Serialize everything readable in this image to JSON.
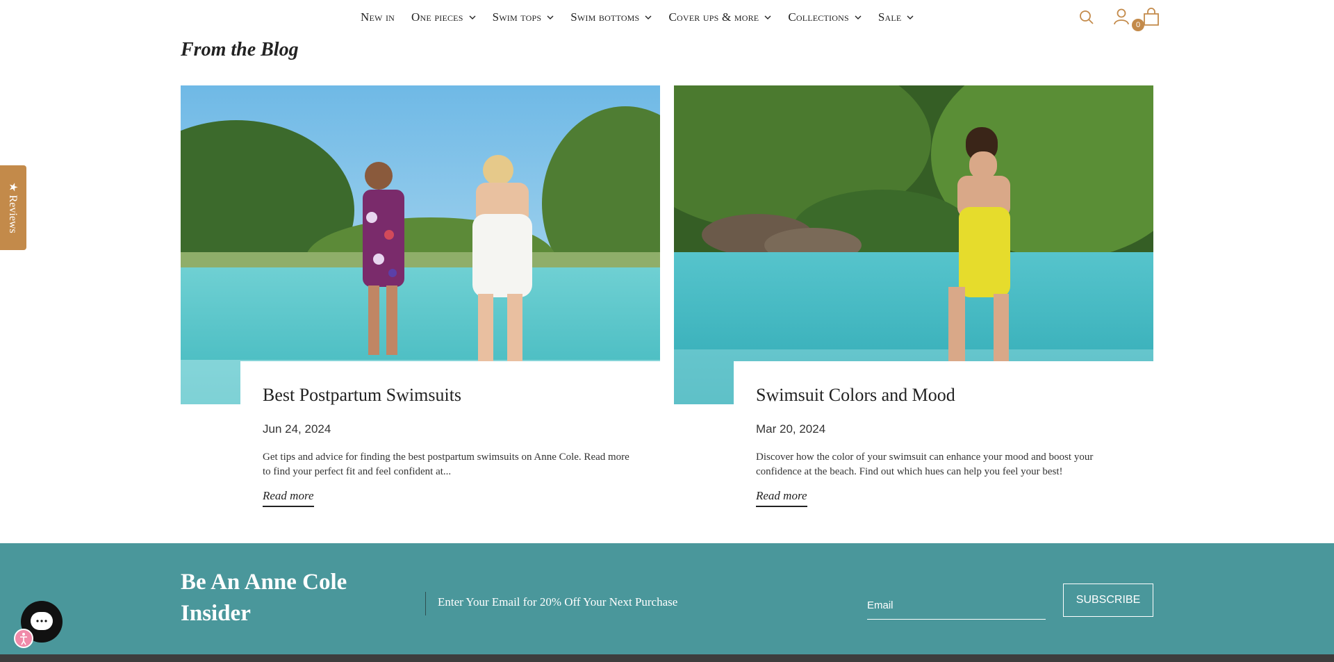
{
  "nav": {
    "items": [
      {
        "label": "New in",
        "has_dropdown": false
      },
      {
        "label": "One pieces",
        "has_dropdown": true
      },
      {
        "label": "Swim tops",
        "has_dropdown": true
      },
      {
        "label": "Swim bottoms",
        "has_dropdown": true
      },
      {
        "label": "Cover ups & more",
        "has_dropdown": true
      },
      {
        "label": "Collections",
        "has_dropdown": true
      },
      {
        "label": "Sale",
        "has_dropdown": true
      }
    ],
    "icons": [
      "search-icon",
      "account-icon",
      "cart-icon"
    ],
    "cart_count": "0",
    "accent_color": "#c38a4a"
  },
  "blog": {
    "heading": "From the Blog",
    "posts": [
      {
        "title": "Best Postpartum Swimsuits",
        "date": "Jun 24, 2024",
        "excerpt": "Get tips and advice for finding the best postpartum swimsuits on Anne Cole. Read more to find your perfect fit and feel confident at...",
        "read_more": "Read more"
      },
      {
        "title": "Swimsuit Colors and Mood",
        "date": "Mar 20, 2024",
        "excerpt": "Discover how the color of your swimsuit can enhance your mood and boost your confidence at the beach. Find out which hues can help you feel your best!",
        "read_more": "Read more"
      }
    ]
  },
  "reviews_tab": {
    "label": "★ Reviews"
  },
  "newsletter": {
    "title": "Be An Anne Cole Insider",
    "text": "Enter Your Email for 20% Off Your Next Purchase",
    "email_placeholder": "Email",
    "button_label": "SUBSCRIBE",
    "background_color": "#4a979b"
  }
}
